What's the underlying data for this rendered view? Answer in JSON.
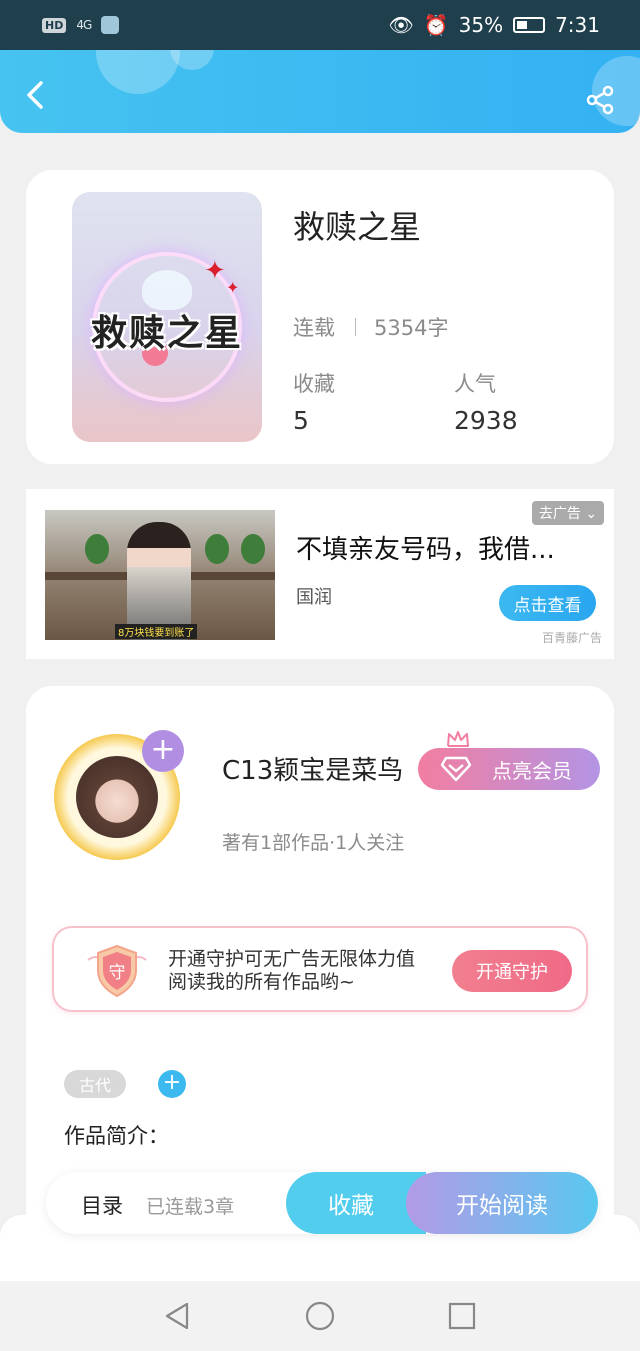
{
  "status_bar": {
    "hd_badge": "HD",
    "signal": "4G",
    "battery_percent": "35%",
    "time": "7:31"
  },
  "book": {
    "cover_title_art": "救赎之星",
    "title": "救赎之星",
    "status": "连载",
    "word_count": "5354字",
    "favorites_label": "收藏",
    "favorites_value": "5",
    "popularity_label": "人气",
    "popularity_value": "2938"
  },
  "ad": {
    "tag": "去广告 ⌄",
    "image_caption": "8万块钱要到账了",
    "title": "不填亲友号码，我借...",
    "brand": "国润",
    "button": "点击查看",
    "source": "百青藤广告"
  },
  "author": {
    "name": "C13颖宝是菜鸟",
    "vip_button": "点亮会员",
    "meta": "著有1部作品·1人关注",
    "guard_icon_char": "守",
    "guard_text": "开通守护可无广告无限体力值阅读我的所有作品哟~",
    "guard_button": "开通守护",
    "tag": "古代",
    "intro_label": "作品简介："
  },
  "action_bar": {
    "toc_label": "目录",
    "toc_count": "已连载3章",
    "favorite_button": "收藏",
    "read_button": "开始阅读"
  },
  "colors": {
    "header_blue": "#3cb8f0",
    "accent_purple": "#b394e4",
    "accent_pink": "#f27ea0"
  },
  "icons": [
    "back-icon",
    "share-icon",
    "plus-icon",
    "gem-icon",
    "crown-icon",
    "shield-icon",
    "nav-back-icon",
    "nav-home-icon",
    "nav-recent-icon"
  ]
}
